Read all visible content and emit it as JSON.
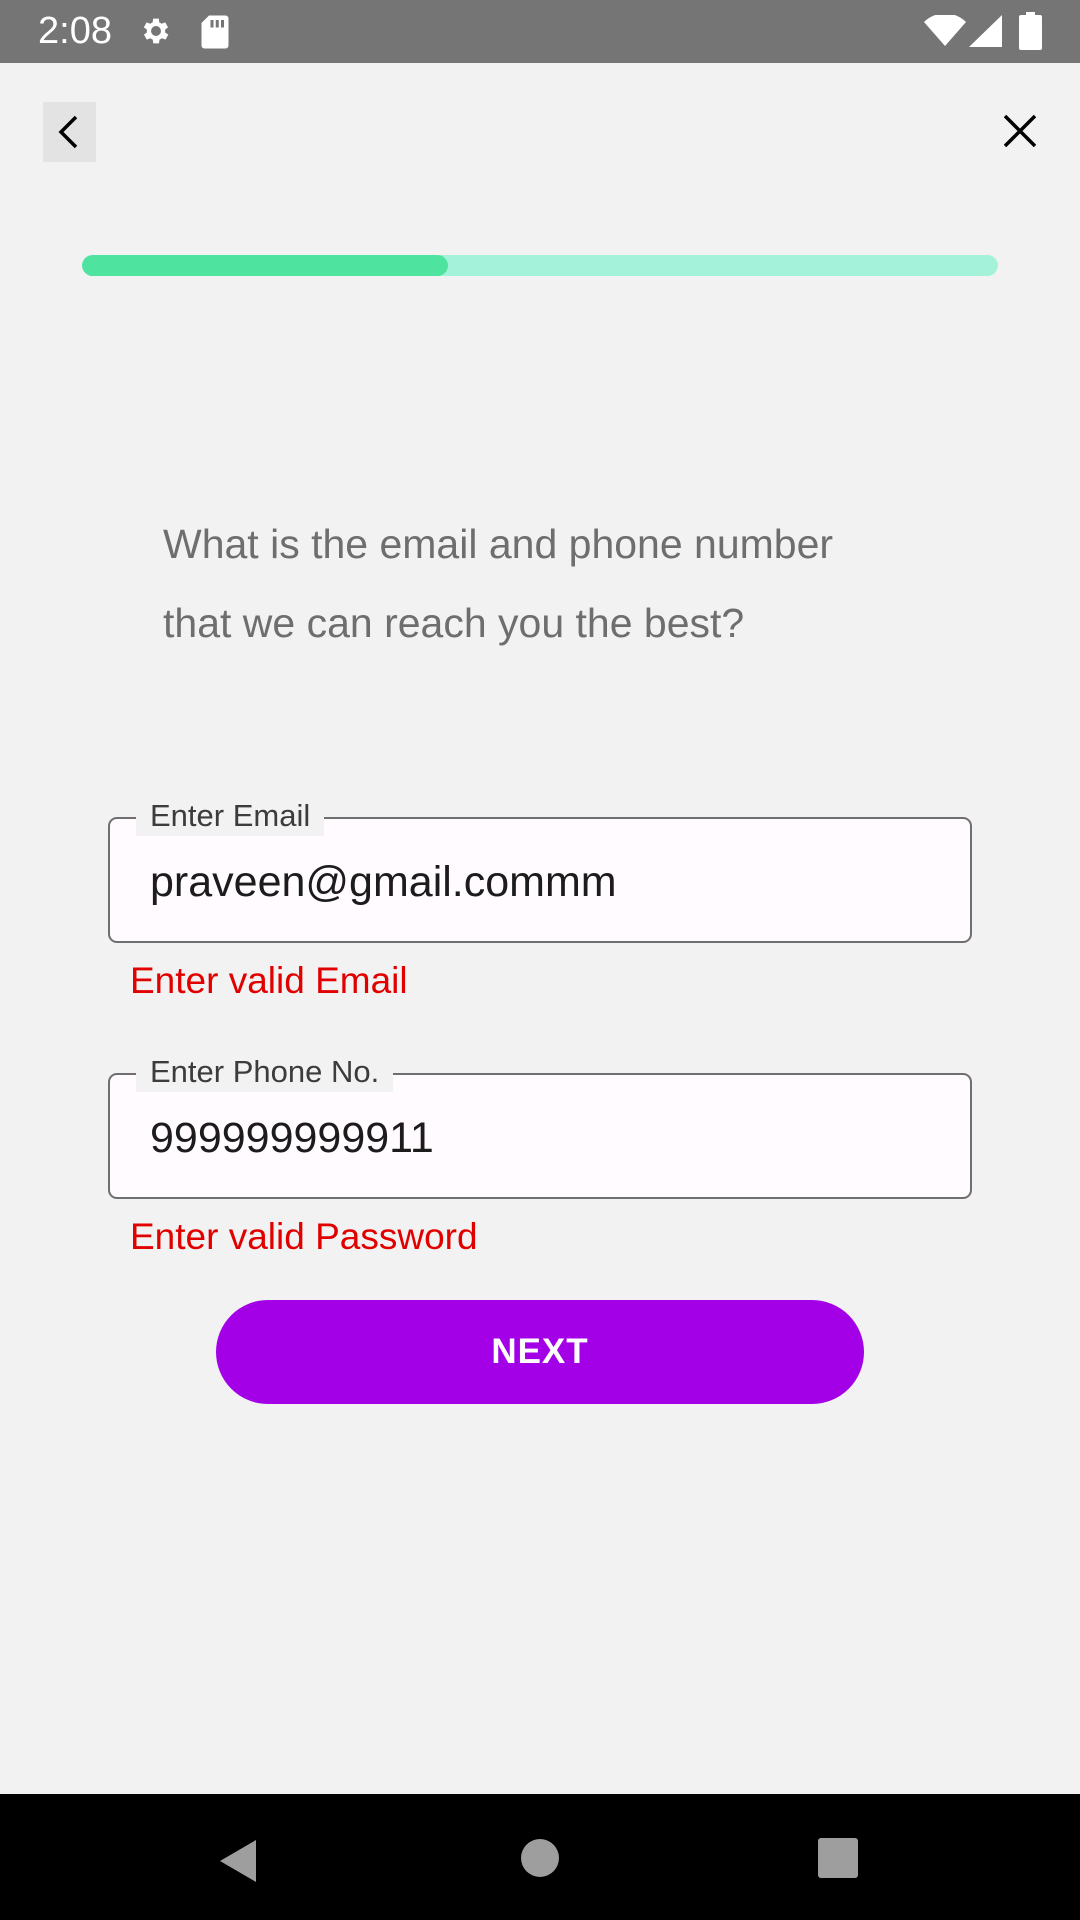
{
  "status_bar": {
    "time": "2:08",
    "icons": [
      "gear-icon",
      "sd-card-icon",
      "wifi-icon",
      "signal-icon",
      "battery-icon"
    ]
  },
  "nav": {
    "back_icon": "chevron-left-icon",
    "close_icon": "close-icon"
  },
  "progress": {
    "value": 0.4,
    "fill_color": "#4ee39f",
    "track_color": "#a4f2da"
  },
  "question": {
    "line1": "What is the email and phone number",
    "line2": "that we can reach you the best?"
  },
  "email_field": {
    "label": "Enter Email",
    "value": "praveen@gmail.commm",
    "error": "Enter valid Email"
  },
  "phone_field": {
    "label": "Enter Phone No.",
    "value": "999999999911",
    "error": "Enter valid Password"
  },
  "next_button": {
    "label": "NEXT",
    "color": "#a400e8"
  },
  "system_nav": {
    "icons": [
      "back-triangle-icon",
      "home-circle-icon",
      "recents-square-icon"
    ]
  },
  "colors": {
    "error": "#e00000",
    "background": "#f2f2f2"
  }
}
